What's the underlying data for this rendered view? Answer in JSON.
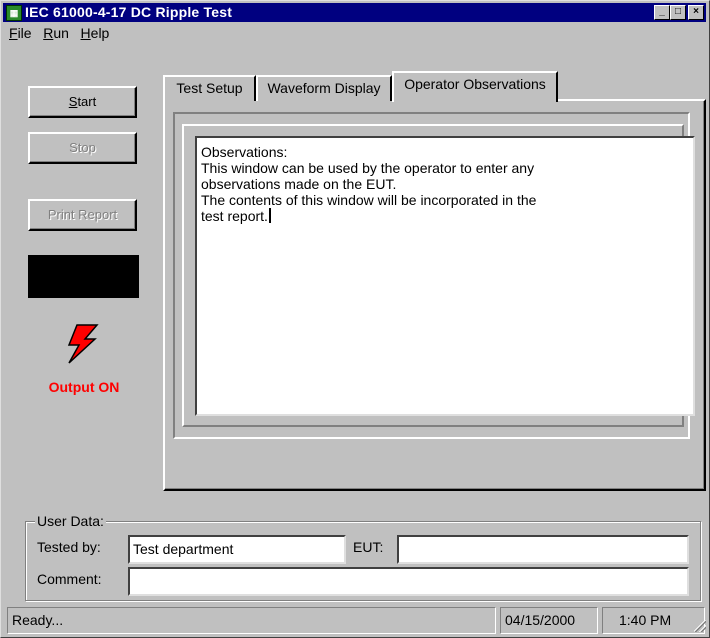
{
  "window": {
    "title": "IEC 61000-4-17 DC Ripple Test",
    "icon": "app-icon"
  },
  "title_buttons": {
    "minimize": "_",
    "maximize": "□",
    "close": "×"
  },
  "menu": {
    "file": {
      "hotkey": "F",
      "rest": "ile"
    },
    "run": {
      "hotkey": "R",
      "rest": "un"
    },
    "help": {
      "hotkey": "H",
      "rest": "elp"
    }
  },
  "controls": {
    "start": {
      "hotkey": "S",
      "rest": "tart"
    },
    "stop": {
      "hotkey": "S",
      "rest": "top"
    },
    "print_report": "Print Report",
    "output_status": "Output ON",
    "output_icon": "lightning-bolt-icon",
    "accent": "#ff0000"
  },
  "tabs": [
    "Test Setup",
    "Waveform Display",
    "Operator Observations"
  ],
  "active_tab": "Operator Observations",
  "observations": {
    "lines": [
      "Observations:",
      "This window can be used by the operator to enter any",
      "observations made on the EUT.",
      "The contents of this window will be incorporated in the",
      "test report."
    ]
  },
  "user_data": {
    "group_label": "User Data:",
    "tested_by_label": "Tested by:",
    "tested_by_value": "Test department",
    "eut_label": "EUT:",
    "eut_value": "",
    "comment_label": "Comment:",
    "comment_value": ""
  },
  "status": {
    "message": "Ready...",
    "date": "04/15/2000",
    "time": "1:40 PM"
  },
  "colors": {
    "title_bar": "#000080",
    "face": "#c0c0c0"
  }
}
